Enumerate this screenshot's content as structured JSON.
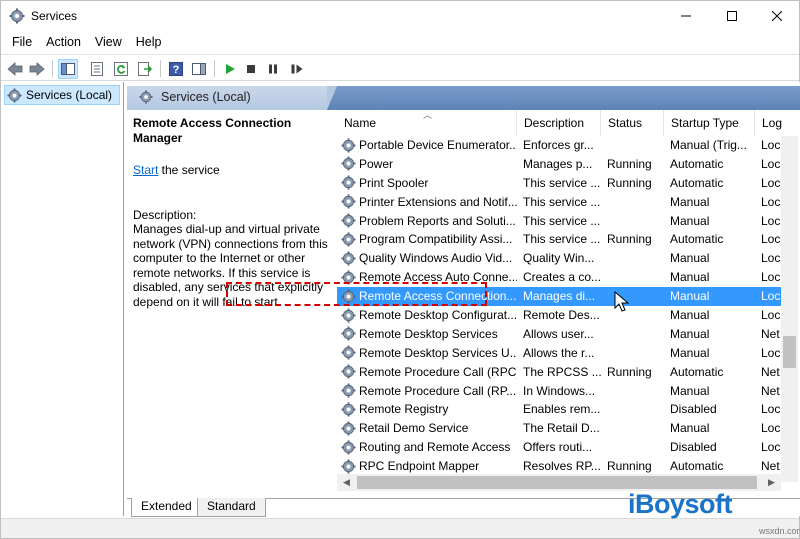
{
  "window": {
    "title": "Services",
    "icons": {
      "app": "gear-icon",
      "minimize": "minimize-icon",
      "maximize": "maximize-icon",
      "close": "close-icon"
    }
  },
  "menu": [
    "File",
    "Action",
    "View",
    "Help"
  ],
  "toolbar": {
    "icons": [
      "back-arrow-icon",
      "forward-arrow-icon",
      "show-hide-console-tree-icon",
      "properties-icon",
      "refresh-icon",
      "export-list-icon",
      "help-icon",
      "action-pane-icon",
      "start-icon",
      "stop-icon",
      "pause-icon",
      "restart-icon"
    ]
  },
  "tree": {
    "item_label": "Services (Local)"
  },
  "panel": {
    "header": "Services (Local)"
  },
  "description": {
    "service_title": "Remote Access Connection Manager",
    "start_link": "Start",
    "start_suffix": " the service",
    "label": "Description:",
    "text": "Manages dial-up and virtual private network (VPN) connections from this computer to the Internet or other remote networks. If this service is disabled, any services that explicitly depend on it will fail to start."
  },
  "columns": {
    "name": "Name",
    "description": "Description",
    "status": "Status",
    "startup_type": "Startup Type",
    "log_on": "Log"
  },
  "services": [
    {
      "name": "Portable Device Enumerator...",
      "desc": "Enforces gr...",
      "status": "",
      "type": "Manual (Trig...",
      "log": "Loc"
    },
    {
      "name": "Power",
      "desc": "Manages p...",
      "status": "Running",
      "type": "Automatic",
      "log": "Loc"
    },
    {
      "name": "Print Spooler",
      "desc": "This service ...",
      "status": "Running",
      "type": "Automatic",
      "log": "Loc"
    },
    {
      "name": "Printer Extensions and Notif...",
      "desc": "This service ...",
      "status": "",
      "type": "Manual",
      "log": "Loc"
    },
    {
      "name": "Problem Reports and Soluti...",
      "desc": "This service ...",
      "status": "",
      "type": "Manual",
      "log": "Loc"
    },
    {
      "name": "Program Compatibility Assi...",
      "desc": "This service ...",
      "status": "Running",
      "type": "Automatic",
      "log": "Loc"
    },
    {
      "name": "Quality Windows Audio Vid...",
      "desc": "Quality Win...",
      "status": "",
      "type": "Manual",
      "log": "Loc"
    },
    {
      "name": "Remote Access Auto Conne...",
      "desc": "Creates a co...",
      "status": "",
      "type": "Manual",
      "log": "Loc"
    },
    {
      "name": "Remote Access Connection...",
      "desc": "Manages di...",
      "status": "",
      "type": "Manual",
      "log": "Loc"
    },
    {
      "name": "Remote Desktop Configurat...",
      "desc": "Remote Des...",
      "status": "",
      "type": "Manual",
      "log": "Loc"
    },
    {
      "name": "Remote Desktop Services",
      "desc": "Allows user...",
      "status": "",
      "type": "Manual",
      "log": "Net"
    },
    {
      "name": "Remote Desktop Services U...",
      "desc": "Allows the r...",
      "status": "",
      "type": "Manual",
      "log": "Loc"
    },
    {
      "name": "Remote Procedure Call (RPC)",
      "desc": "The RPCSS ...",
      "status": "Running",
      "type": "Automatic",
      "log": "Net"
    },
    {
      "name": "Remote Procedure Call (RP...",
      "desc": "In Windows...",
      "status": "",
      "type": "Manual",
      "log": "Net"
    },
    {
      "name": "Remote Registry",
      "desc": "Enables rem...",
      "status": "",
      "type": "Disabled",
      "log": "Loc"
    },
    {
      "name": "Retail Demo Service",
      "desc": "The Retail D...",
      "status": "",
      "type": "Manual",
      "log": "Loc"
    },
    {
      "name": "Routing and Remote Access",
      "desc": "Offers routi...",
      "status": "",
      "type": "Disabled",
      "log": "Loc"
    },
    {
      "name": "RPC Endpoint Mapper",
      "desc": "Resolves RP...",
      "status": "Running",
      "type": "Automatic",
      "log": "Net"
    }
  ],
  "selected_index": 8,
  "tabs": [
    "Extended",
    "Standard"
  ],
  "watermark": {
    "brand": "iBoysoft",
    "site": "wsxdn.com"
  },
  "colors": {
    "selection": "#3399ff",
    "highlight_outline": "#d40000",
    "brand": "#1a73c9"
  }
}
